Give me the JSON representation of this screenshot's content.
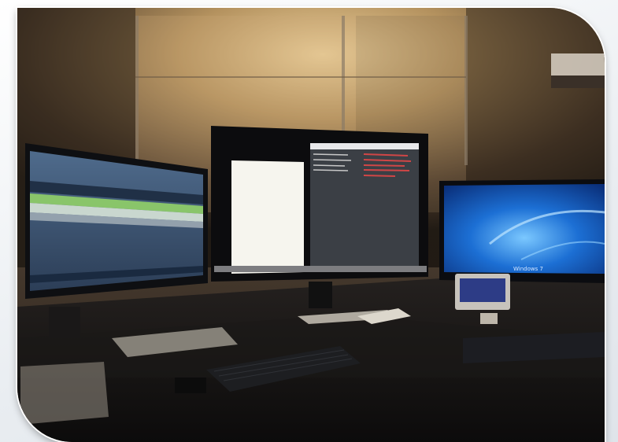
{
  "scene": {
    "center_monitor_text": "",
    "right_monitor_caption": "Windows 7"
  }
}
